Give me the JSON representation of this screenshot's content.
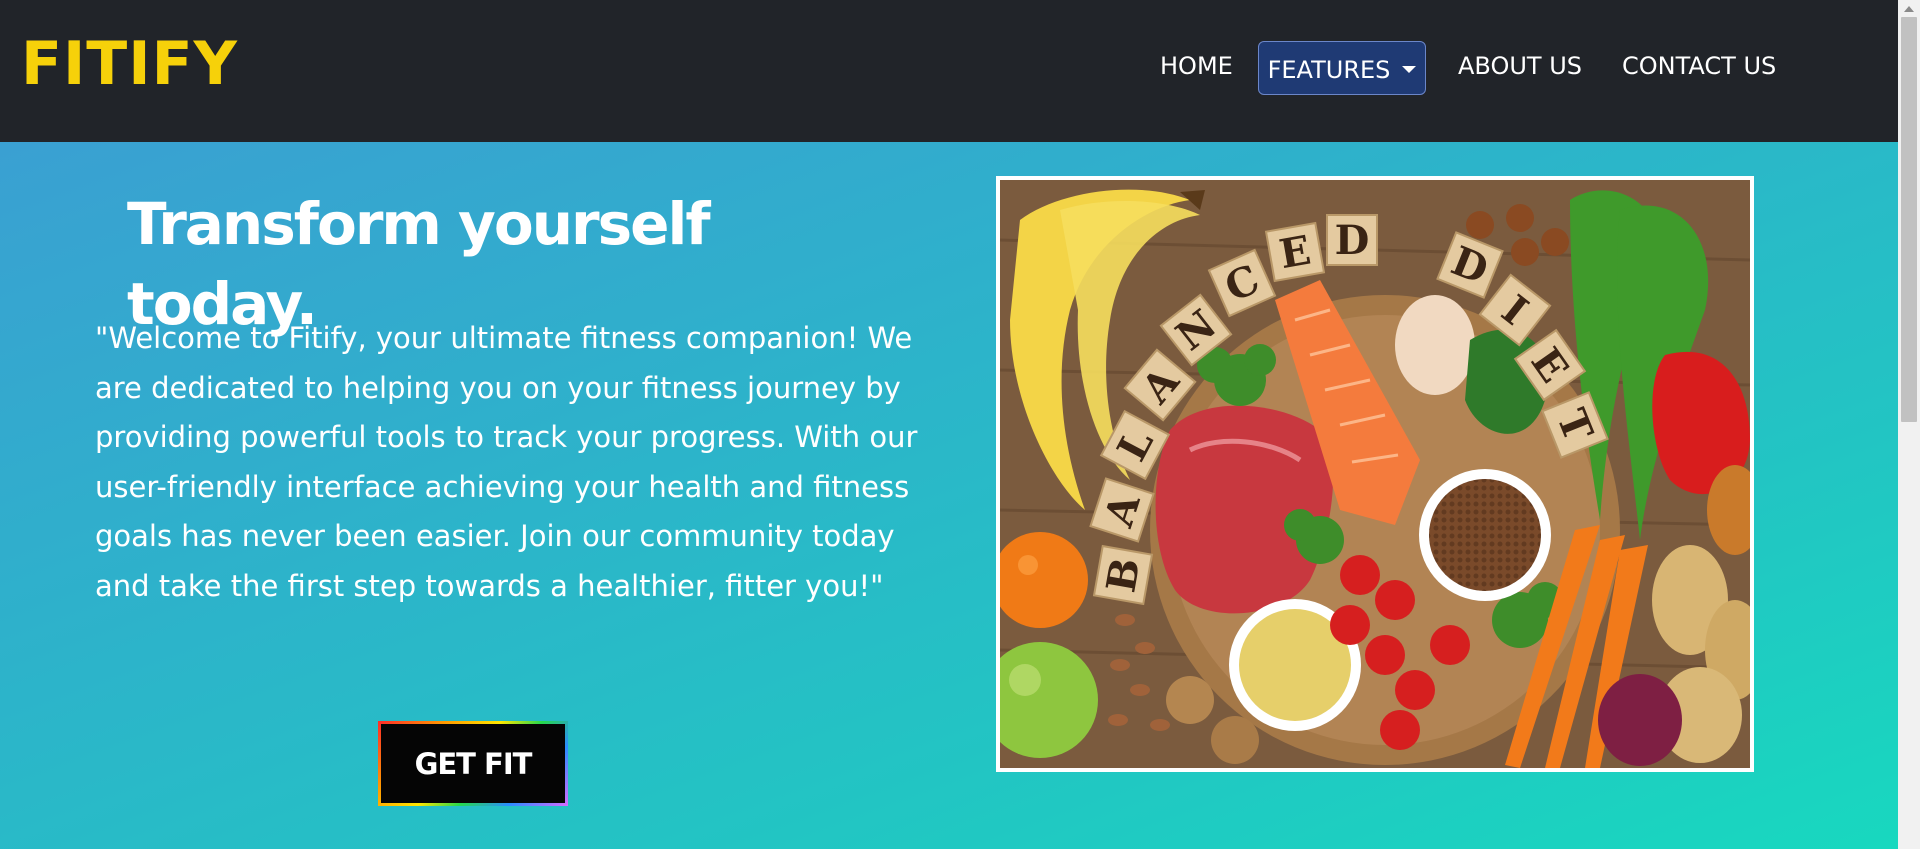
{
  "nav": {
    "brand": "FITIFY",
    "links": {
      "home": "HOME",
      "features": "FEATURES",
      "about": "ABOUT US",
      "contact": "CONTACT US"
    }
  },
  "hero": {
    "title": "Transform yourself today.",
    "text": "\"Welcome to Fitify, your ultimate fitness companion! We are dedicated to helping you on your fitness journey by providing powerful tools to track your progress. With our user-friendly interface achieving your health and fitness goals has never been easier. Join our community today and take the first step towards a healthier, fitter you!\"",
    "cta": "GET FIT"
  },
  "image": {
    "tiles_left": [
      "B",
      "A",
      "L",
      "A",
      "N",
      "C",
      "E",
      "D"
    ],
    "tiles_right": [
      "D",
      "I",
      "E",
      "T"
    ]
  },
  "colors": {
    "brand": "#f6d10a",
    "navbar": "#212429",
    "features_button": "#1f3a74",
    "hero_gradient_start": "#3aa0d2",
    "hero_gradient_end": "#18d8bf"
  },
  "icons": {
    "features_dropdown": "caret-down-icon"
  }
}
